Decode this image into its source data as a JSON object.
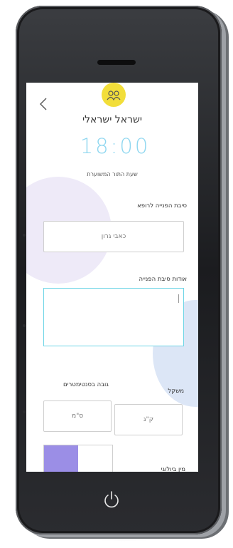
{
  "header": {
    "user_name": "ישראל ישראלי",
    "appointment_time": "18:00",
    "appointment_time_caption": "שעת התור המשוערת"
  },
  "form": {
    "reason_label": "סיבת הפנייה לרופא",
    "reason_value": "כאבי גרון",
    "about_label": "אודות סיבת הפנייה",
    "height_label": "גובה בסנטימטרים",
    "height_unit": "ס\"מ",
    "weight_label": "משקל",
    "weight_unit": "ק\"ג",
    "gender_label": "מין ביולוגי"
  },
  "colors": {
    "accent_cyan": "#6ed5e6",
    "logo_yellow": "#f2de3a",
    "toggle_purple": "#9b8ee6"
  },
  "icons": {
    "back": "chevron-left-icon",
    "logo": "people-icon",
    "home": "power-icon"
  }
}
